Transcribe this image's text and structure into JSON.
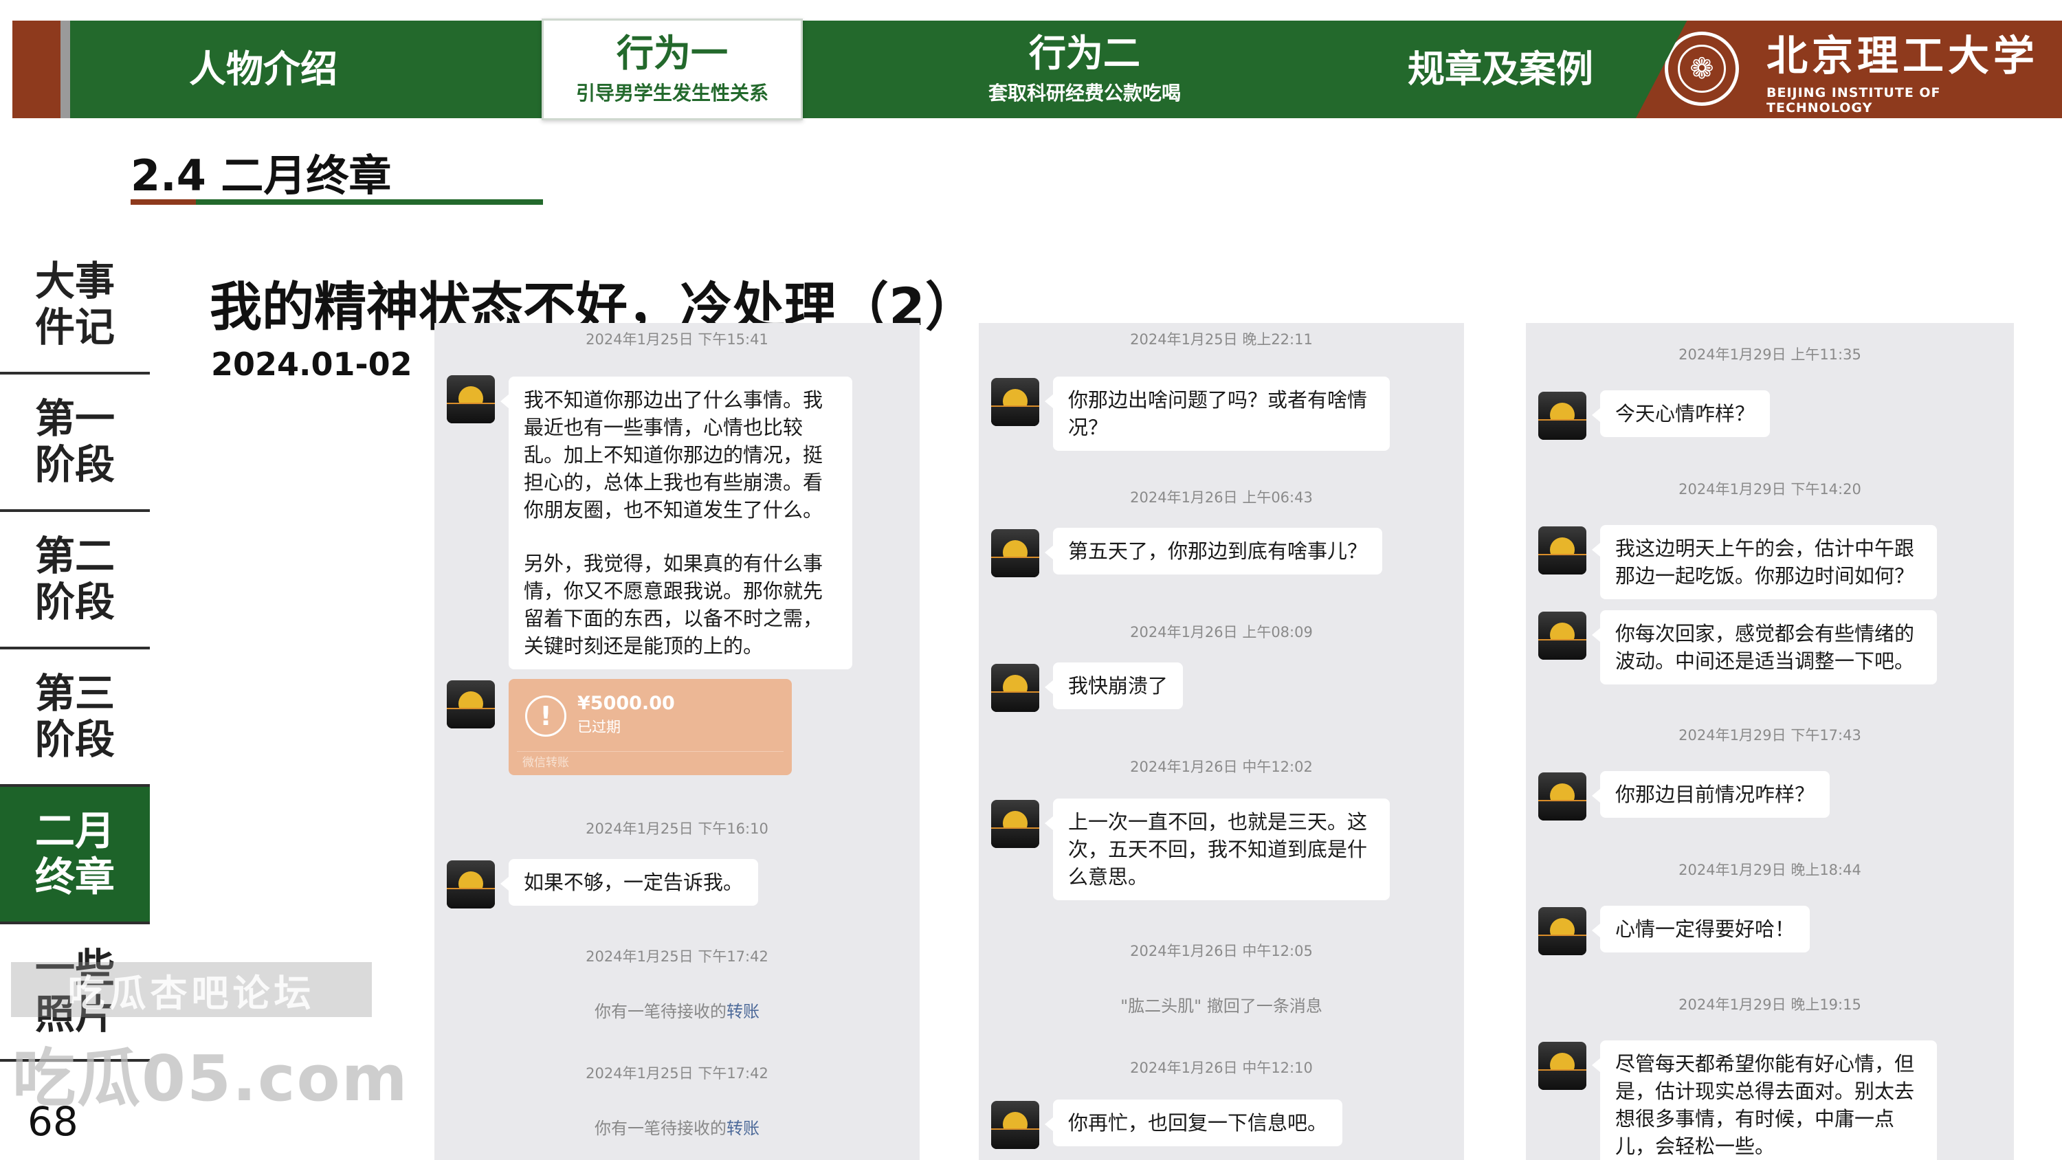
{
  "top_nav": {
    "tabs": [
      {
        "label": "人物介绍",
        "sub": ""
      },
      {
        "label": "行为一",
        "sub": "引导男学生发生性关系"
      },
      {
        "label": "行为二",
        "sub": "套取科研经费公款吃喝"
      },
      {
        "label": "规章及案例",
        "sub": ""
      }
    ],
    "university_cn": "北京理工大学",
    "university_en": "BEIJING INSTITUTE OF TECHNOLOGY"
  },
  "section_title": "2.4 二月终章",
  "sidebar": {
    "items": [
      {
        "label": "大事件记"
      },
      {
        "label": "第一阶段"
      },
      {
        "label": "第二阶段"
      },
      {
        "label": "第三阶段"
      },
      {
        "label": "二月终章"
      },
      {
        "label": "一些照片"
      }
    ]
  },
  "page_number": "68",
  "heading": "我的精神状态不好，冷处理（2）",
  "date": "2024.01-02",
  "watermark": {
    "line1": "吃瓜杏吧论坛",
    "line2": "吃瓜05.com"
  },
  "chat1": {
    "ts1": "2024年1月25日 下午15:41",
    "msg1_p1": "我不知道你那边出了什么事情。我最近也有一些事情，心情也比较乱。加上不知道你那边的情况，挺担心的，总体上我也有些崩溃。看你朋友圈，也不知道发生了什么。",
    "msg1_p2": "另外，我觉得，如果真的有什么事情，你又不愿意跟我说。那你就先留着下面的东西，以备不时之需，关键时刻还是能顶的上的。",
    "transfer_amount": "¥5000.00",
    "transfer_status": "已过期",
    "transfer_source": "微信转账",
    "ts2": "2024年1月25日 下午16:10",
    "msg2": "如果不够，一定告诉我。",
    "ts3": "2024年1月25日 下午17:42",
    "sys1": "你有一笔待接收的",
    "sys1_link": "转账",
    "ts4": "2024年1月25日 下午17:42",
    "sys2": "你有一笔待接收的",
    "sys2_link": "转账"
  },
  "chat2": {
    "ts1": "2024年1月25日 晚上22:11",
    "msg1": "你那边出啥问题了吗？或者有啥情况？",
    "ts2": "2024年1月26日 上午06:43",
    "msg2": "第五天了，你那边到底有啥事儿？",
    "ts3": "2024年1月26日 上午08:09",
    "msg3": "我快崩溃了",
    "ts4": "2024年1月26日 中午12:02",
    "msg4": "上一次一直不回，也就是三天。这次，五天不回，我不知道到底是什么意思。",
    "ts5": "2024年1月26日 中午12:05",
    "sys1": "\"肱二头肌\" 撤回了一条消息",
    "ts6": "2024年1月26日 中午12:10",
    "msg5": "你再忙，也回复一下信息吧。"
  },
  "chat3": {
    "ts1": "2024年1月29日 上午11:35",
    "msg1": "今天心情咋样？",
    "ts2": "2024年1月29日 下午14:20",
    "msg2": "我这边明天上午的会，估计中午跟那边一起吃饭。你那边时间如何？",
    "msg3": "你每次回家，感觉都会有些情绪的波动。中间还是适当调整一下吧。",
    "ts3": "2024年1月29日 下午17:43",
    "msg4": "你那边目前情况咋样？",
    "ts4": "2024年1月29日 晚上18:44",
    "msg5": "心情一定得要好哈！",
    "ts5": "2024年1月29日 晚上19:15",
    "msg6": "尽管每天都希望你能有好心情，但是，估计现实总得去面对。别太去想很多事情，有时候，中庸一点儿，会轻松一些。"
  },
  "colors": {
    "primary_green": "#23692c",
    "accent_brown": "#8e3a1d",
    "chat_bg": "#e9e9ec",
    "transfer_orange": "#ecb795"
  }
}
